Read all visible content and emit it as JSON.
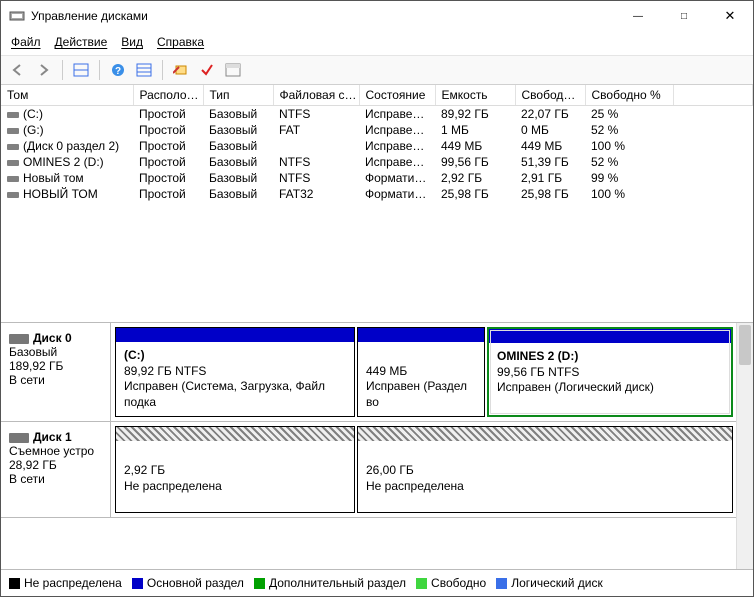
{
  "window": {
    "title": "Управление дисками",
    "minimize_glyph": "—",
    "maximize_glyph": "□",
    "close_glyph": "✕"
  },
  "menu": {
    "file": "Файл",
    "action": "Действие",
    "view": "Вид",
    "help": "Справка"
  },
  "columns": {
    "tom": "Том",
    "raspol": "Располо…",
    "tip": "Тип",
    "fs": "Файловая с…",
    "state": "Состояние",
    "cap": "Емкость",
    "free": "Свобод…",
    "freepct": "Свободно %"
  },
  "vols": [
    {
      "name": "(C:)",
      "layout": "Простой",
      "type": "Базовый",
      "fs": "NTFS",
      "state": "Исправен…",
      "cap": "89,92 ГБ",
      "free": "22,07 ГБ",
      "pct": "25 %"
    },
    {
      "name": "(G:)",
      "layout": "Простой",
      "type": "Базовый",
      "fs": "FAT",
      "state": "Исправен…",
      "cap": "1 МБ",
      "free": "0 МБ",
      "pct": "52 %"
    },
    {
      "name": "(Диск 0 раздел 2)",
      "layout": "Простой",
      "type": "Базовый",
      "fs": "",
      "state": "Исправен…",
      "cap": "449 МБ",
      "free": "449 МБ",
      "pct": "100 %"
    },
    {
      "name": "OMINES 2 (D:)",
      "layout": "Простой",
      "type": "Базовый",
      "fs": "NTFS",
      "state": "Исправен…",
      "cap": "99,56 ГБ",
      "free": "51,39 ГБ",
      "pct": "52 %"
    },
    {
      "name": "Новый том",
      "layout": "Простой",
      "type": "Базовый",
      "fs": "NTFS",
      "state": "Формати…",
      "cap": "2,92 ГБ",
      "free": "2,91 ГБ",
      "pct": "99 %"
    },
    {
      "name": "НОВЫЙ ТОМ",
      "layout": "Простой",
      "type": "Базовый",
      "fs": "FAT32",
      "state": "Формати…",
      "cap": "25,98 ГБ",
      "free": "25,98 ГБ",
      "pct": "100 %"
    }
  ],
  "disk0": {
    "name": "Диск 0",
    "type": "Базовый",
    "size": "189,92 ГБ",
    "status": "В сети",
    "p1": {
      "title": "(C:)",
      "line2": "89,92 ГБ NTFS",
      "line3": "Исправен (Система, Загрузка, Файл подка"
    },
    "p2": {
      "title": "",
      "line2": "449 МБ",
      "line3": "Исправен (Раздел во"
    },
    "p3": {
      "title": "OMINES 2  (D:)",
      "line2": "99,56 ГБ NTFS",
      "line3": "Исправен (Логический диск)"
    }
  },
  "disk1": {
    "name": "Диск 1",
    "type": "Съемное устро",
    "size": "28,92 ГБ",
    "status": "В сети",
    "p1": {
      "line2": "2,92 ГБ",
      "line3": "Не распределена"
    },
    "p2": {
      "line2": "26,00 ГБ",
      "line3": "Не распределена"
    }
  },
  "legend": {
    "unalloc": "Не распределена",
    "primary": "Основной раздел",
    "extended": "Дополнительный раздел",
    "free": "Свободно",
    "logical": "Логический диск"
  }
}
